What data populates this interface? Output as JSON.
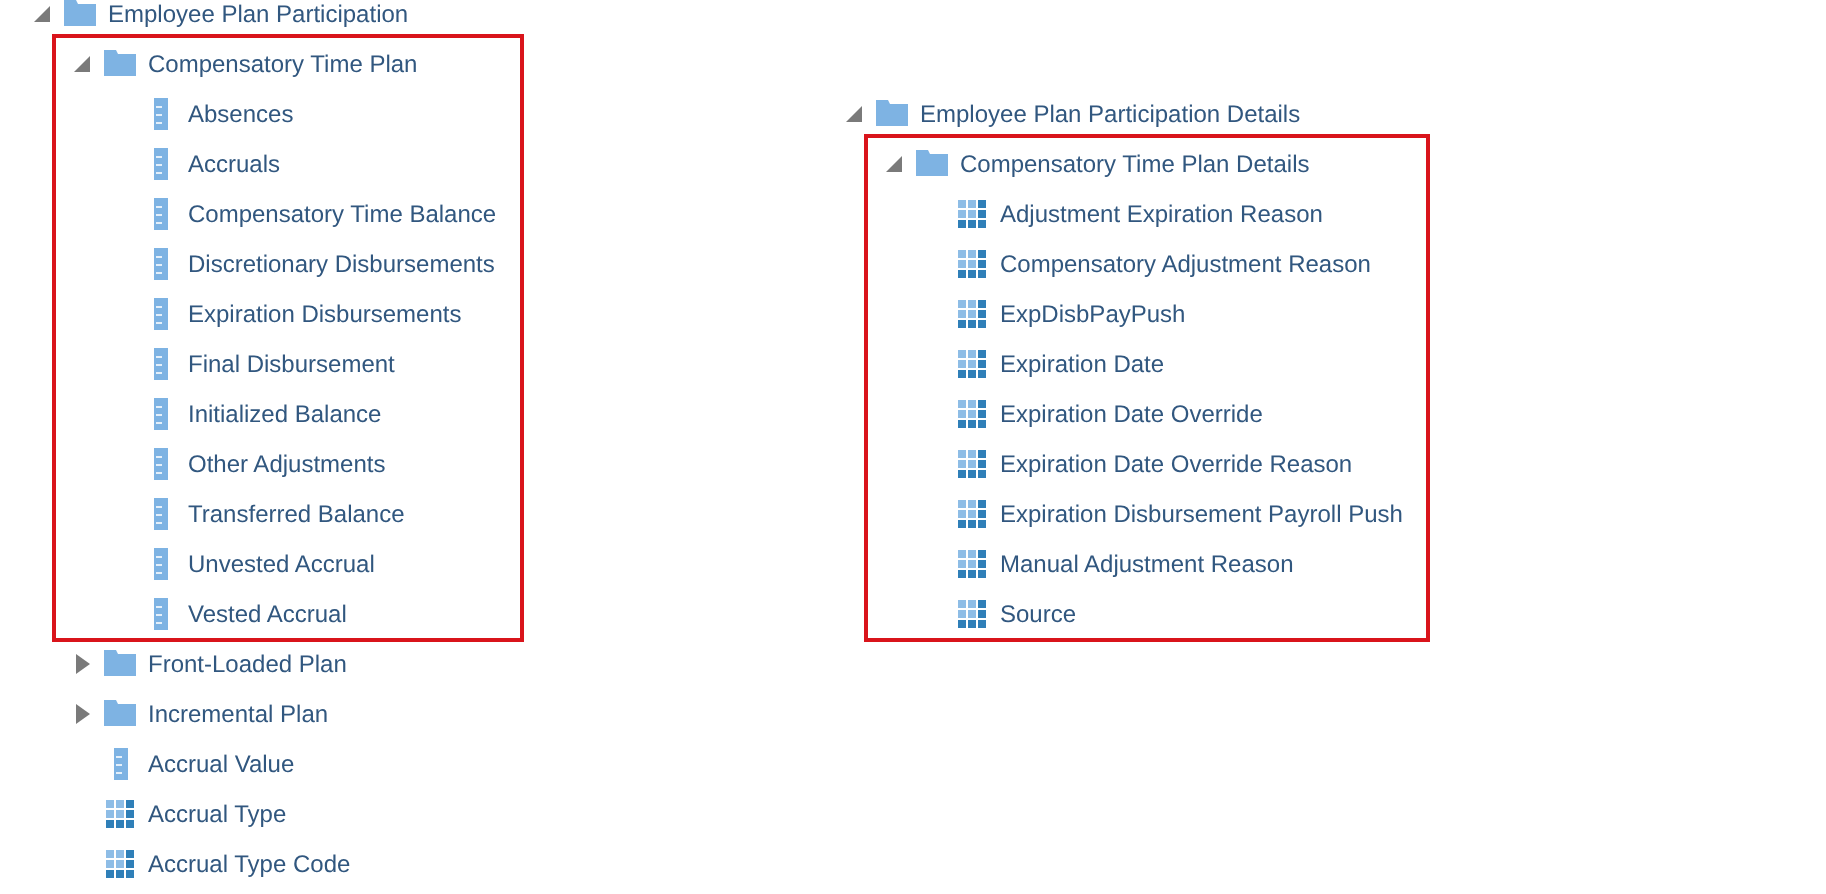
{
  "trees": [
    {
      "label": "Employee Plan Participation",
      "kind": "folder",
      "expanded": true,
      "highlighted": false,
      "children": [
        {
          "label": "Compensatory Time Plan",
          "kind": "folder",
          "expanded": true,
          "highlighted": true,
          "children": [
            {
              "label": "Absences",
              "kind": "measure"
            },
            {
              "label": "Accruals",
              "kind": "measure"
            },
            {
              "label": "Compensatory Time Balance",
              "kind": "measure"
            },
            {
              "label": "Discretionary Disbursements",
              "kind": "measure"
            },
            {
              "label": "Expiration Disbursements",
              "kind": "measure"
            },
            {
              "label": "Final Disbursement",
              "kind": "measure"
            },
            {
              "label": "Initialized Balance",
              "kind": "measure"
            },
            {
              "label": "Other Adjustments",
              "kind": "measure"
            },
            {
              "label": "Transferred Balance",
              "kind": "measure"
            },
            {
              "label": "Unvested Accrual",
              "kind": "measure"
            },
            {
              "label": "Vested Accrual",
              "kind": "measure"
            }
          ]
        },
        {
          "label": "Front-Loaded Plan",
          "kind": "folder",
          "expanded": false,
          "highlighted": false
        },
        {
          "label": "Incremental Plan",
          "kind": "folder",
          "expanded": false,
          "highlighted": false
        },
        {
          "label": "Accrual Value",
          "kind": "measure"
        },
        {
          "label": "Accrual Type",
          "kind": "attribute"
        },
        {
          "label": "Accrual Type Code",
          "kind": "attribute"
        }
      ]
    },
    {
      "label": "Employee Plan Participation Details",
      "kind": "folder",
      "expanded": true,
      "highlighted": false,
      "children": [
        {
          "label": "Compensatory Time Plan Details",
          "kind": "folder",
          "expanded": true,
          "highlighted": true,
          "children": [
            {
              "label": "Adjustment Expiration Reason",
              "kind": "attribute"
            },
            {
              "label": "Compensatory Adjustment Reason",
              "kind": "attribute"
            },
            {
              "label": "ExpDisbPayPush",
              "kind": "attribute"
            },
            {
              "label": "Expiration Date",
              "kind": "attribute"
            },
            {
              "label": "Expiration Date Override",
              "kind": "attribute"
            },
            {
              "label": "Expiration Date Override Reason",
              "kind": "attribute"
            },
            {
              "label": "Expiration Disbursement Payroll Push",
              "kind": "attribute"
            },
            {
              "label": "Manual Adjustment Reason",
              "kind": "attribute"
            },
            {
              "label": "Source",
              "kind": "attribute"
            }
          ]
        }
      ]
    }
  ]
}
